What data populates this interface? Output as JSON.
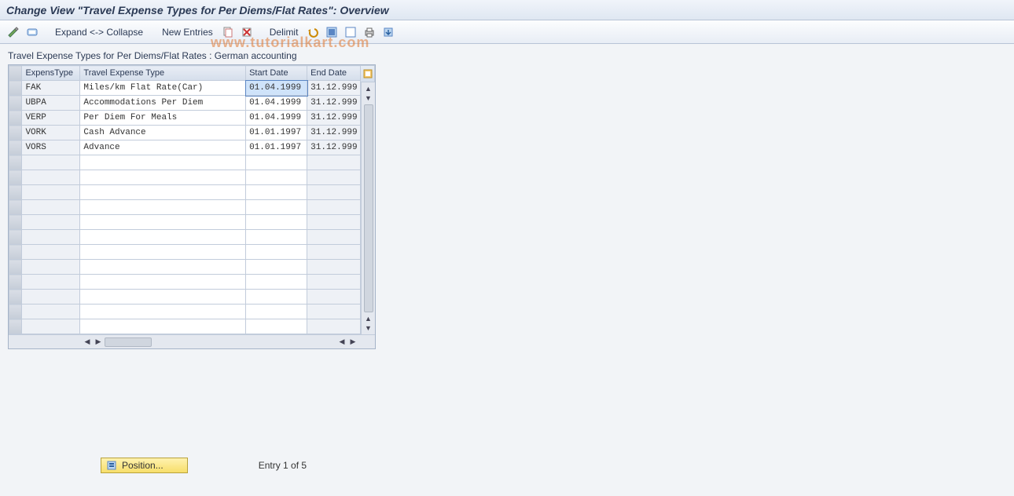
{
  "title": "Change View \"Travel Expense Types for Per Diems/Flat Rates\": Overview",
  "toolbar": {
    "expand_collapse": "Expand <-> Collapse",
    "new_entries": "New Entries",
    "delimit": "Delimit"
  },
  "section_title": "Travel Expense Types for Per Diems/Flat Rates : German accounting",
  "columns": {
    "c1": "ExpensType",
    "c2": "Travel Expense Type",
    "c3": "Start Date",
    "c4": "End Date"
  },
  "rows": [
    {
      "code": "FAK",
      "desc": "Miles/km Flat Rate(Car)",
      "start": "01.04.1999",
      "end": "31.12.999",
      "selected": true
    },
    {
      "code": "UBPA",
      "desc": "Accommodations Per Diem",
      "start": "01.04.1999",
      "end": "31.12.999",
      "selected": false
    },
    {
      "code": "VERP",
      "desc": "Per Diem For Meals",
      "start": "01.04.1999",
      "end": "31.12.999",
      "selected": false
    },
    {
      "code": "VORK",
      "desc": "Cash Advance",
      "start": "01.01.1997",
      "end": "31.12.999",
      "selected": false
    },
    {
      "code": "VORS",
      "desc": "Advance",
      "start": "01.01.1997",
      "end": "31.12.999",
      "selected": false
    }
  ],
  "empty_row_count": 12,
  "footer": {
    "position_label": "Position...",
    "entry_text": "Entry 1 of 5"
  },
  "watermark": "www.tutorialkart.com"
}
